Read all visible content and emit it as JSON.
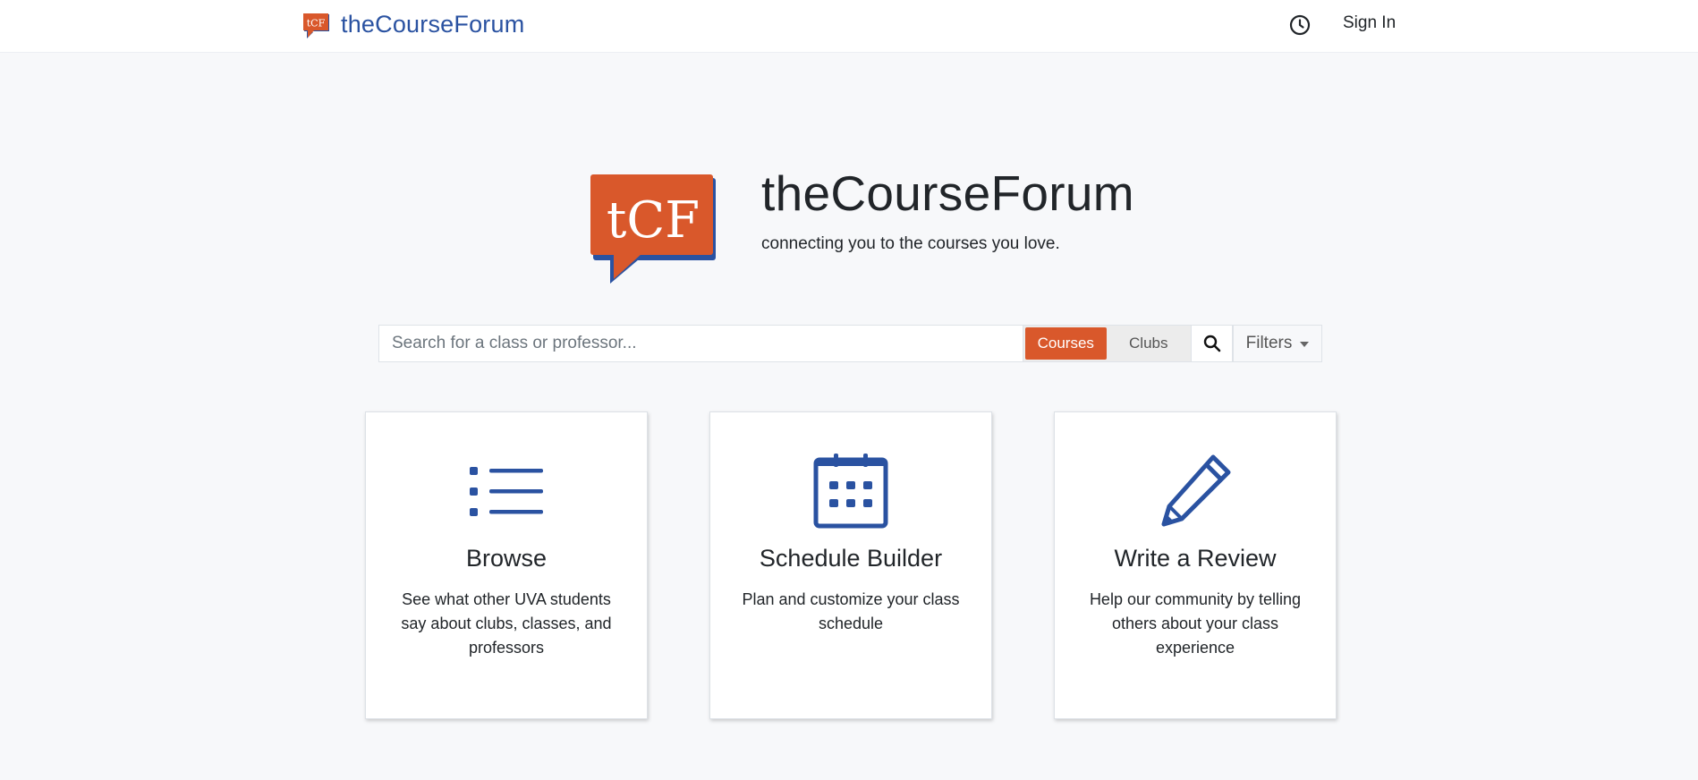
{
  "navbar": {
    "brand_logo_text": "tCF",
    "brand_text": "theCourseForum",
    "sign_in": "Sign In"
  },
  "hero": {
    "logo_text": "tCF",
    "title": "theCourseForum",
    "tagline": "connecting you to the courses you love."
  },
  "search": {
    "placeholder": "Search for a class or professor...",
    "value": "",
    "mode_courses": "Courses",
    "mode_clubs": "Clubs",
    "selected_mode": "Courses",
    "filters_label": "Filters"
  },
  "cards": [
    {
      "icon": "list-icon",
      "title": "Browse",
      "text": "See what other UVA students say about clubs, classes, and professors"
    },
    {
      "icon": "calendar-icon",
      "title": "Schedule Builder",
      "text": "Plan and customize your class schedule"
    },
    {
      "icon": "pencil-icon",
      "title": "Write a Review",
      "text": "Help our community by telling others about your class experience"
    }
  ],
  "colors": {
    "brand_blue": "#2a52a1",
    "brand_orange": "#d9582b",
    "background": "#f7f8fa"
  }
}
